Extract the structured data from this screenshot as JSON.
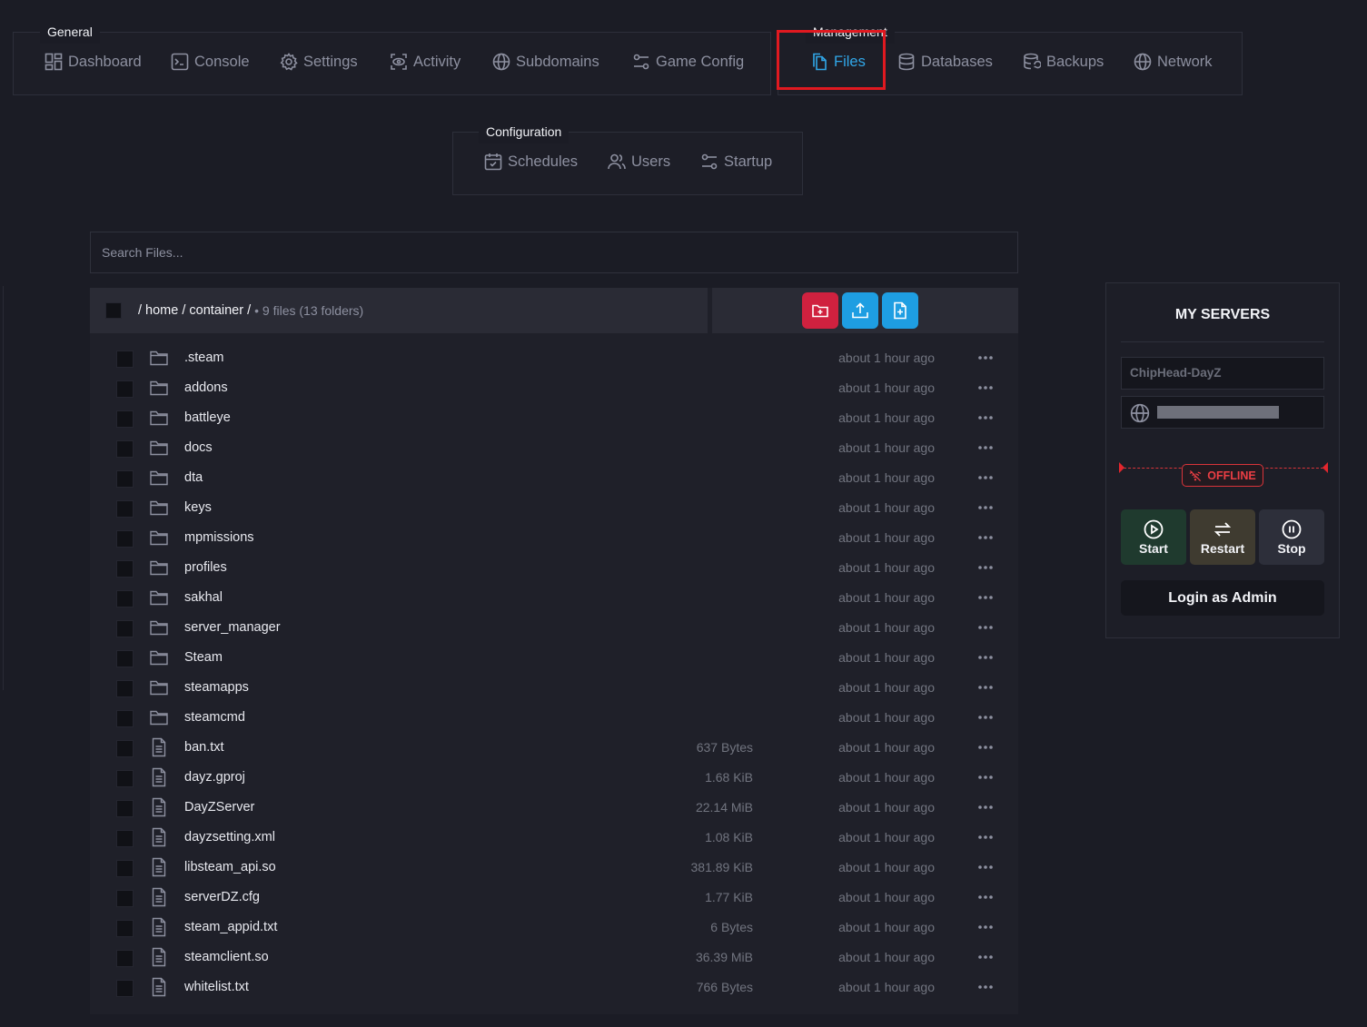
{
  "nav": {
    "general": {
      "title": "General",
      "items": [
        {
          "label": "Dashboard",
          "icon": "dashboard-icon"
        },
        {
          "label": "Console",
          "icon": "console-icon"
        },
        {
          "label": "Settings",
          "icon": "gear-icon"
        },
        {
          "label": "Activity",
          "icon": "activity-icon"
        },
        {
          "label": "Subdomains",
          "icon": "globe-icon"
        },
        {
          "label": "Game Config",
          "icon": "sliders-icon"
        }
      ]
    },
    "management": {
      "title": "Management",
      "items": [
        {
          "label": "Files",
          "icon": "files-icon",
          "active": true
        },
        {
          "label": "Databases",
          "icon": "database-icon"
        },
        {
          "label": "Backups",
          "icon": "backups-icon"
        },
        {
          "label": "Network",
          "icon": "globe-icon"
        }
      ]
    },
    "configuration": {
      "title": "Configuration",
      "items": [
        {
          "label": "Schedules",
          "icon": "calendar-icon"
        },
        {
          "label": "Users",
          "icon": "users-icon"
        },
        {
          "label": "Startup",
          "icon": "sliders-icon"
        }
      ]
    }
  },
  "search": {
    "placeholder": "Search Files..."
  },
  "file_manager": {
    "path": "/ home / container /",
    "count": "• 9 files (13 folders)",
    "actions": [
      {
        "name": "new-folder-button",
        "color": "#d0213f"
      },
      {
        "name": "upload-button",
        "color": "#1e9ee2"
      },
      {
        "name": "new-file-button",
        "color": "#1e9ee2"
      }
    ],
    "files": [
      {
        "name": ".steam",
        "type": "folder",
        "size": "",
        "modified": "about 1 hour ago"
      },
      {
        "name": "addons",
        "type": "folder",
        "size": "",
        "modified": "about 1 hour ago"
      },
      {
        "name": "battleye",
        "type": "folder",
        "size": "",
        "modified": "about 1 hour ago"
      },
      {
        "name": "docs",
        "type": "folder",
        "size": "",
        "modified": "about 1 hour ago"
      },
      {
        "name": "dta",
        "type": "folder",
        "size": "",
        "modified": "about 1 hour ago"
      },
      {
        "name": "keys",
        "type": "folder",
        "size": "",
        "modified": "about 1 hour ago"
      },
      {
        "name": "mpmissions",
        "type": "folder",
        "size": "",
        "modified": "about 1 hour ago"
      },
      {
        "name": "profiles",
        "type": "folder",
        "size": "",
        "modified": "about 1 hour ago"
      },
      {
        "name": "sakhal",
        "type": "folder",
        "size": "",
        "modified": "about 1 hour ago"
      },
      {
        "name": "server_manager",
        "type": "folder",
        "size": "",
        "modified": "about 1 hour ago"
      },
      {
        "name": "Steam",
        "type": "folder",
        "size": "",
        "modified": "about 1 hour ago"
      },
      {
        "name": "steamapps",
        "type": "folder",
        "size": "",
        "modified": "about 1 hour ago"
      },
      {
        "name": "steamcmd",
        "type": "folder",
        "size": "",
        "modified": "about 1 hour ago"
      },
      {
        "name": "ban.txt",
        "type": "file",
        "size": "637 Bytes",
        "modified": "about 1 hour ago"
      },
      {
        "name": "dayz.gproj",
        "type": "file",
        "size": "1.68 KiB",
        "modified": "about 1 hour ago"
      },
      {
        "name": "DayZServer",
        "type": "file",
        "size": "22.14 MiB",
        "modified": "about 1 hour ago"
      },
      {
        "name": "dayzsetting.xml",
        "type": "file",
        "size": "1.08 KiB",
        "modified": "about 1 hour ago"
      },
      {
        "name": "libsteam_api.so",
        "type": "file",
        "size": "381.89 KiB",
        "modified": "about 1 hour ago"
      },
      {
        "name": "serverDZ.cfg",
        "type": "file",
        "size": "1.77 KiB",
        "modified": "about 1 hour ago"
      },
      {
        "name": "steam_appid.txt",
        "type": "file",
        "size": "6 Bytes",
        "modified": "about 1 hour ago"
      },
      {
        "name": "steamclient.so",
        "type": "file",
        "size": "36.39 MiB",
        "modified": "about 1 hour ago"
      },
      {
        "name": "whitelist.txt",
        "type": "file",
        "size": "766 Bytes",
        "modified": "about 1 hour ago"
      }
    ]
  },
  "servers": {
    "title": "MY SERVERS",
    "server_name": "ChipHead-DayZ",
    "status": "OFFLINE",
    "status_color": "#ea3e44",
    "buttons": {
      "start": "Start",
      "restart": "Restart",
      "stop": "Stop"
    },
    "login": "Login as Admin"
  },
  "colors": {
    "accent": "#31a7e8",
    "highlight": "#e01920",
    "background": "#1b1c25"
  }
}
